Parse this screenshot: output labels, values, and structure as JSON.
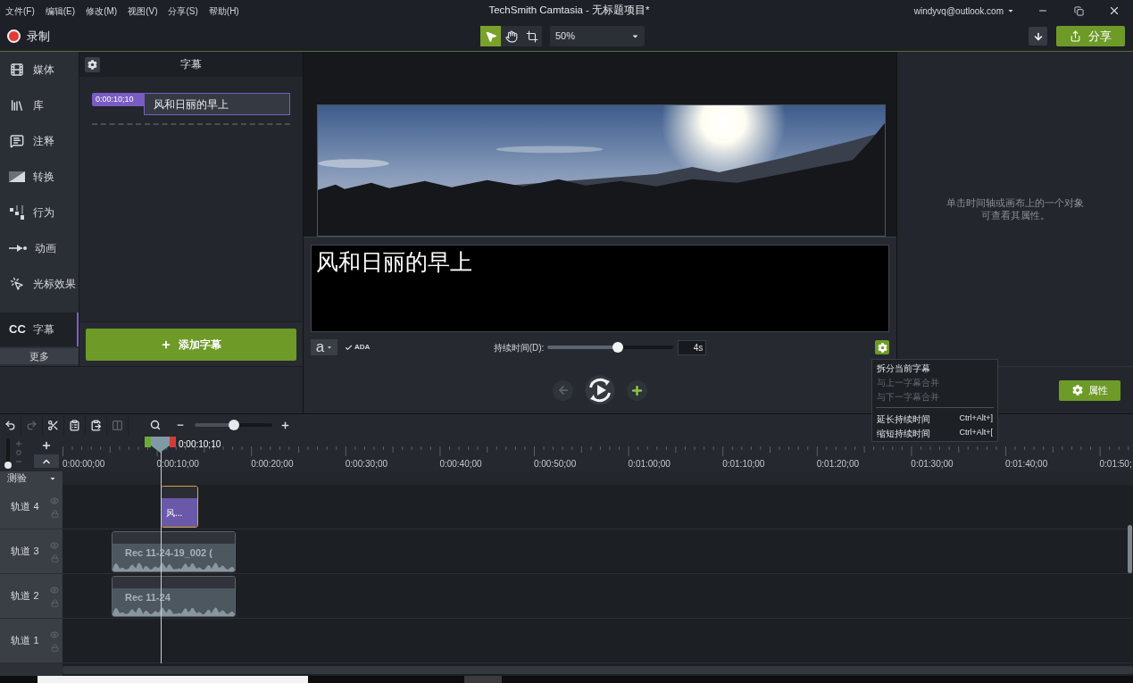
{
  "title_bar": {
    "menus": [
      "文件(F)",
      "编辑(E)",
      "修改(M)",
      "视图(V)",
      "分享(S)",
      "帮助(H)"
    ],
    "title": "TechSmith Camtasia - 无标题项目*",
    "account": "windyvq@outlook.com"
  },
  "toolbar": {
    "record_label": "录制",
    "tools": [
      {
        "kind": "pointer",
        "selected": true
      },
      {
        "kind": "hand",
        "selected": false
      },
      {
        "kind": "crop",
        "selected": false
      }
    ],
    "zoom": "50%",
    "share_label": "分享"
  },
  "sidebar": {
    "items": [
      {
        "kind": "media",
        "label": "媒体",
        "selected": false
      },
      {
        "kind": "library",
        "label": "库",
        "selected": false
      },
      {
        "kind": "annotations",
        "label": "注释",
        "selected": false
      },
      {
        "kind": "transitions",
        "label": "转换",
        "selected": false
      },
      {
        "kind": "behaviors",
        "label": "行为",
        "selected": false
      },
      {
        "kind": "animations",
        "label": "动画",
        "selected": false
      },
      {
        "kind": "cursor",
        "label": "光标效果",
        "selected": false
      },
      {
        "kind": "captions",
        "icon_text": "CC",
        "label": "字幕",
        "selected": true
      }
    ],
    "more_label": "更多"
  },
  "captions_panel": {
    "title": "字幕",
    "captions": [
      {
        "time": "0:00:10;10",
        "text": "风和日丽的早上",
        "selected": true
      }
    ],
    "add_label": "添加字幕"
  },
  "canvas": {
    "caption_text": "风和日丽的早上",
    "font_label": "a",
    "ada": {
      "label": "ADA",
      "checked": true
    },
    "duration_label": "持续时间(D):",
    "duration": {
      "level": 0.56
    },
    "duration_value": "4s",
    "previous_disabled": true
  },
  "context_menu": {
    "groups": [
      {
        "items": [
          {
            "label": "拆分当前字幕",
            "disabled": false
          },
          {
            "label": "与上一字幕合并",
            "disabled": true
          },
          {
            "label": "与下一字幕合并",
            "disabled": true
          }
        ]
      },
      {
        "items": [
          {
            "label": "延长持续时间",
            "shortcut": "Ctrl+Alt+]",
            "disabled": false
          },
          {
            "label": "缩短持续时间",
            "shortcut": "Ctrl+Alt+[",
            "disabled": false
          }
        ]
      }
    ]
  },
  "properties_panel": {
    "hint": "单击时间轴或画布上的一个对象可查看其属性。",
    "button_label": "属性"
  },
  "timeline": {
    "tools": [
      {
        "kind": "undo",
        "disabled": false
      },
      {
        "kind": "redo",
        "disabled": true
      },
      {
        "kind": "cut",
        "disabled": false
      },
      {
        "kind": "copy",
        "disabled": false
      },
      {
        "kind": "paste",
        "disabled": false
      },
      {
        "kind": "split",
        "disabled": true
      }
    ],
    "zoom": {
      "level": 0.5
    },
    "track_height": {
      "level": 0
    },
    "playhead_time": "0:00:10;10",
    "ruler_labels": [
      "0:00:00;00",
      "0:00:10;00",
      "0:00:20;00",
      "0:00:30;00",
      "0:00:40;00",
      "0:00:50;00",
      "0:01:00;00",
      "0:01:10;00",
      "0:01:20;00",
      "0:01:30;00",
      "0:01:40;00",
      "0:01:50;"
    ],
    "quiz_label": "测验",
    "tracks": [
      {
        "label": "轨道 4",
        "clips": [
          {
            "kind": "caption",
            "text": "风...",
            "selected": true
          }
        ]
      },
      {
        "label": "轨道 3",
        "clips": [
          {
            "kind": "media",
            "text": "Rec 11-24-19_002 (",
            "selected": false
          }
        ]
      },
      {
        "label": "轨道 2",
        "clips": [
          {
            "kind": "media",
            "text": "Rec 11-24",
            "selected": false
          }
        ]
      },
      {
        "label": "轨道 1"
      }
    ]
  }
}
